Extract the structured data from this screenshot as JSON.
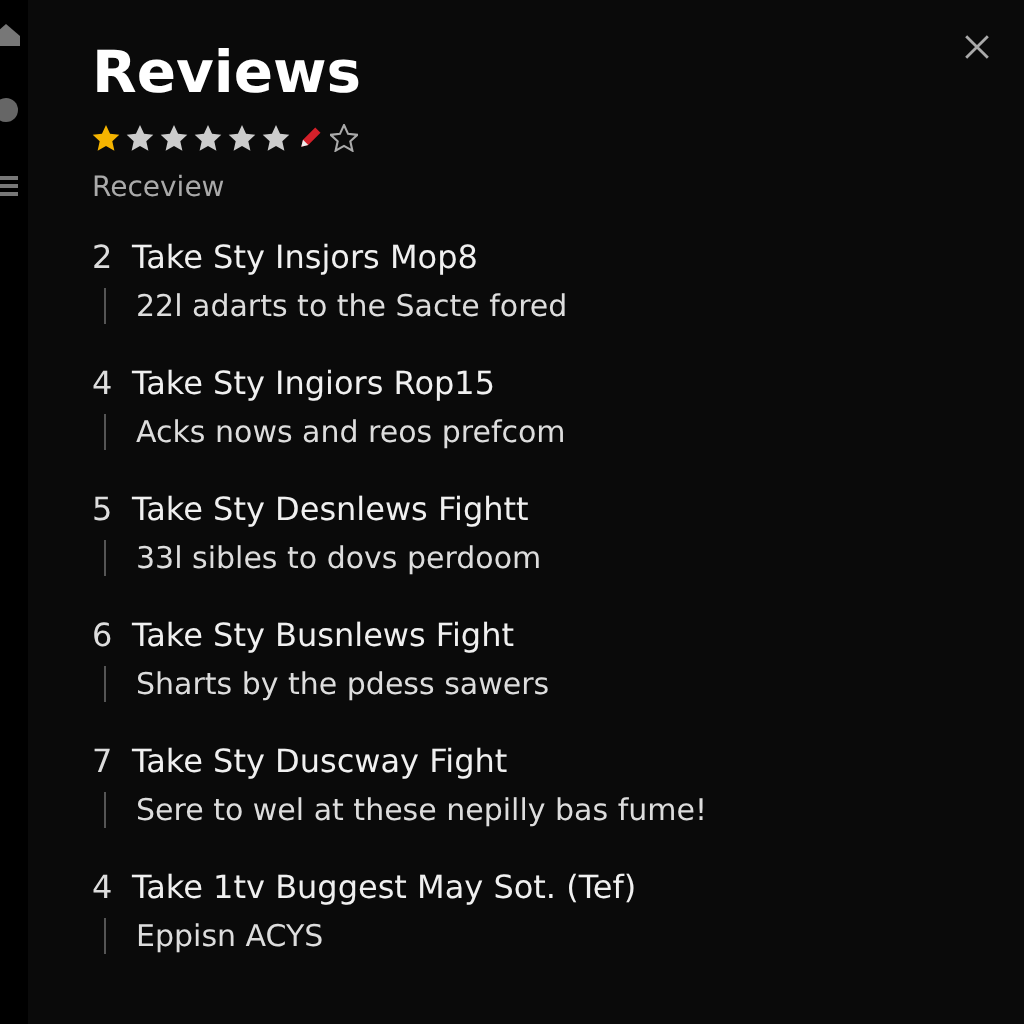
{
  "title": "Reviews",
  "rating": {
    "stars": 1
  },
  "subtitle": "Receview",
  "reviews": [
    {
      "number": "2",
      "title": "Take Sty Insjors Mop8",
      "text": "22l adarts to the Sacte fored"
    },
    {
      "number": "4",
      "title": "Take Sty Ingiors Rop15",
      "text": "Acks nows and reos prefcom"
    },
    {
      "number": "5",
      "title": "Take Sty Desnlews Fightt",
      "text": "33l sibles to dovs perdoom"
    },
    {
      "number": "6",
      "title": "Take Sty Busnlews Fight",
      "text": "Sharts by the pdess sawers"
    },
    {
      "number": "7",
      "title": "Take Sty Duscway Fight",
      "text": "Sere to wel at these nepilly bas fume!"
    },
    {
      "number": "4",
      "title": "Take 1tv Buggest May Sot. (Tef)",
      "text": "Eppisn ACYS"
    }
  ]
}
